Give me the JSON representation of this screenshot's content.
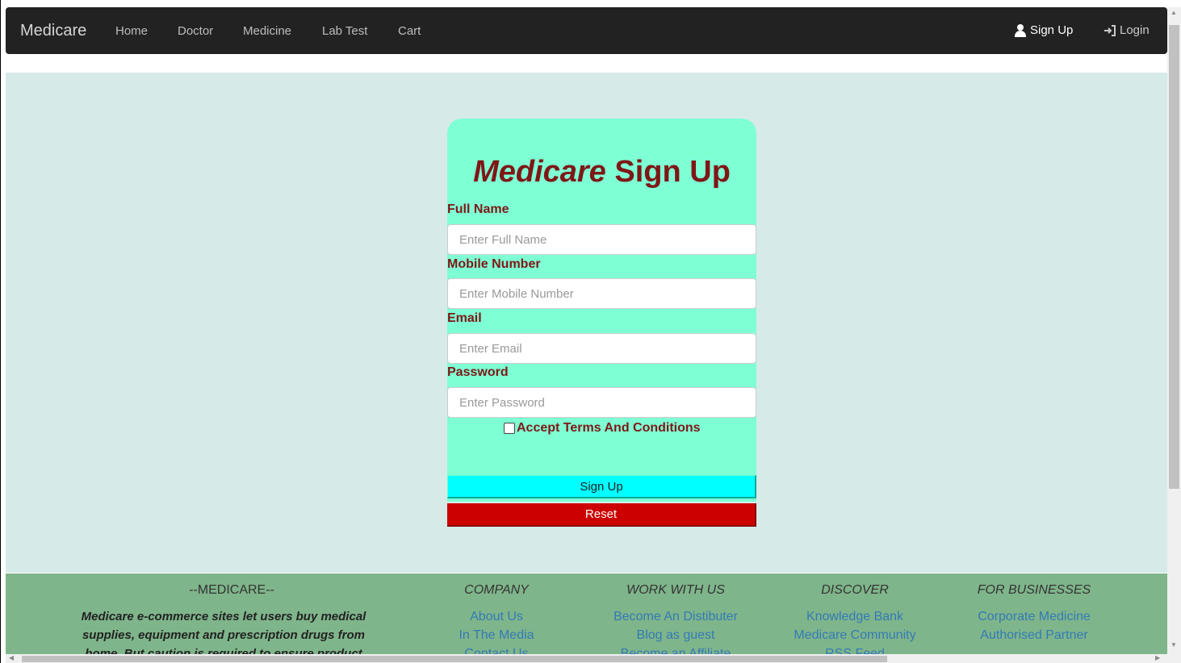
{
  "navbar": {
    "brand": "Medicare",
    "links": [
      "Home",
      "Doctor",
      "Medicine",
      "Lab Test",
      "Cart"
    ],
    "signup_label": "Sign Up",
    "login_label": "Login",
    "signup_icon": "user-icon",
    "login_icon": "login-icon"
  },
  "form": {
    "title_part1": "Medicare",
    "title_part2": "Sign",
    "title_part3": "Up",
    "fields": [
      {
        "label": "Full Name",
        "placeholder": "Enter Full Name"
      },
      {
        "label": "Mobile Number",
        "placeholder": "Enter Mobile Number"
      },
      {
        "label": "Email",
        "placeholder": "Enter Email"
      },
      {
        "label": "Password",
        "placeholder": "Enter Password"
      }
    ],
    "terms_label": "Accept Terms And Conditions",
    "signup_button": "Sign Up",
    "reset_button": "Reset"
  },
  "footer": {
    "medicare_heading": "--MEDICARE--",
    "description_lines": [
      "Medicare e-commerce sites let users buy medical",
      "supplies, equipment and prescription drugs from",
      "home. But caution is required to ensure product"
    ],
    "columns": [
      {
        "heading": "COMPANY",
        "items": [
          "About Us",
          "In The Media",
          "Contact Us"
        ]
      },
      {
        "heading": "WORK WITH US",
        "items": [
          "Become An Distibuter",
          "Blog as guest",
          "Become an Affiliate"
        ]
      },
      {
        "heading": "DISCOVER",
        "items": [
          "Knowledge Bank",
          "Medicare Community",
          "RSS Feed"
        ]
      },
      {
        "heading": "FOR BUSINESSES",
        "items": [
          "Corporate Medicine",
          "Authorised Partner"
        ]
      }
    ]
  },
  "colors": {
    "navbar_bg": "#222222",
    "page_bg": "#d6eae8",
    "card_bg": "#7fffd4",
    "title_color": "#7e1717",
    "signup_btn": "#00ffff",
    "reset_btn": "#cc0000",
    "footer_bg": "#7fb58a",
    "link_color": "#337ab7"
  }
}
